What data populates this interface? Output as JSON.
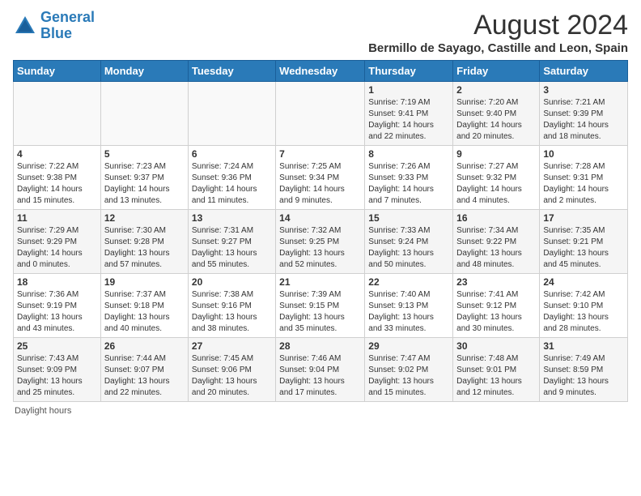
{
  "logo": {
    "line1": "General",
    "line2": "Blue"
  },
  "title": "August 2024",
  "subtitle": "Bermillo de Sayago, Castille and Leon, Spain",
  "headers": [
    "Sunday",
    "Monday",
    "Tuesday",
    "Wednesday",
    "Thursday",
    "Friday",
    "Saturday"
  ],
  "footer": "Daylight hours",
  "weeks": [
    [
      {
        "day": "",
        "info": ""
      },
      {
        "day": "",
        "info": ""
      },
      {
        "day": "",
        "info": ""
      },
      {
        "day": "",
        "info": ""
      },
      {
        "day": "1",
        "info": "Sunrise: 7:19 AM\nSunset: 9:41 PM\nDaylight: 14 hours\nand 22 minutes."
      },
      {
        "day": "2",
        "info": "Sunrise: 7:20 AM\nSunset: 9:40 PM\nDaylight: 14 hours\nand 20 minutes."
      },
      {
        "day": "3",
        "info": "Sunrise: 7:21 AM\nSunset: 9:39 PM\nDaylight: 14 hours\nand 18 minutes."
      }
    ],
    [
      {
        "day": "4",
        "info": "Sunrise: 7:22 AM\nSunset: 9:38 PM\nDaylight: 14 hours\nand 15 minutes."
      },
      {
        "day": "5",
        "info": "Sunrise: 7:23 AM\nSunset: 9:37 PM\nDaylight: 14 hours\nand 13 minutes."
      },
      {
        "day": "6",
        "info": "Sunrise: 7:24 AM\nSunset: 9:36 PM\nDaylight: 14 hours\nand 11 minutes."
      },
      {
        "day": "7",
        "info": "Sunrise: 7:25 AM\nSunset: 9:34 PM\nDaylight: 14 hours\nand 9 minutes."
      },
      {
        "day": "8",
        "info": "Sunrise: 7:26 AM\nSunset: 9:33 PM\nDaylight: 14 hours\nand 7 minutes."
      },
      {
        "day": "9",
        "info": "Sunrise: 7:27 AM\nSunset: 9:32 PM\nDaylight: 14 hours\nand 4 minutes."
      },
      {
        "day": "10",
        "info": "Sunrise: 7:28 AM\nSunset: 9:31 PM\nDaylight: 14 hours\nand 2 minutes."
      }
    ],
    [
      {
        "day": "11",
        "info": "Sunrise: 7:29 AM\nSunset: 9:29 PM\nDaylight: 14 hours\nand 0 minutes."
      },
      {
        "day": "12",
        "info": "Sunrise: 7:30 AM\nSunset: 9:28 PM\nDaylight: 13 hours\nand 57 minutes."
      },
      {
        "day": "13",
        "info": "Sunrise: 7:31 AM\nSunset: 9:27 PM\nDaylight: 13 hours\nand 55 minutes."
      },
      {
        "day": "14",
        "info": "Sunrise: 7:32 AM\nSunset: 9:25 PM\nDaylight: 13 hours\nand 52 minutes."
      },
      {
        "day": "15",
        "info": "Sunrise: 7:33 AM\nSunset: 9:24 PM\nDaylight: 13 hours\nand 50 minutes."
      },
      {
        "day": "16",
        "info": "Sunrise: 7:34 AM\nSunset: 9:22 PM\nDaylight: 13 hours\nand 48 minutes."
      },
      {
        "day": "17",
        "info": "Sunrise: 7:35 AM\nSunset: 9:21 PM\nDaylight: 13 hours\nand 45 minutes."
      }
    ],
    [
      {
        "day": "18",
        "info": "Sunrise: 7:36 AM\nSunset: 9:19 PM\nDaylight: 13 hours\nand 43 minutes."
      },
      {
        "day": "19",
        "info": "Sunrise: 7:37 AM\nSunset: 9:18 PM\nDaylight: 13 hours\nand 40 minutes."
      },
      {
        "day": "20",
        "info": "Sunrise: 7:38 AM\nSunset: 9:16 PM\nDaylight: 13 hours\nand 38 minutes."
      },
      {
        "day": "21",
        "info": "Sunrise: 7:39 AM\nSunset: 9:15 PM\nDaylight: 13 hours\nand 35 minutes."
      },
      {
        "day": "22",
        "info": "Sunrise: 7:40 AM\nSunset: 9:13 PM\nDaylight: 13 hours\nand 33 minutes."
      },
      {
        "day": "23",
        "info": "Sunrise: 7:41 AM\nSunset: 9:12 PM\nDaylight: 13 hours\nand 30 minutes."
      },
      {
        "day": "24",
        "info": "Sunrise: 7:42 AM\nSunset: 9:10 PM\nDaylight: 13 hours\nand 28 minutes."
      }
    ],
    [
      {
        "day": "25",
        "info": "Sunrise: 7:43 AM\nSunset: 9:09 PM\nDaylight: 13 hours\nand 25 minutes."
      },
      {
        "day": "26",
        "info": "Sunrise: 7:44 AM\nSunset: 9:07 PM\nDaylight: 13 hours\nand 22 minutes."
      },
      {
        "day": "27",
        "info": "Sunrise: 7:45 AM\nSunset: 9:06 PM\nDaylight: 13 hours\nand 20 minutes."
      },
      {
        "day": "28",
        "info": "Sunrise: 7:46 AM\nSunset: 9:04 PM\nDaylight: 13 hours\nand 17 minutes."
      },
      {
        "day": "29",
        "info": "Sunrise: 7:47 AM\nSunset: 9:02 PM\nDaylight: 13 hours\nand 15 minutes."
      },
      {
        "day": "30",
        "info": "Sunrise: 7:48 AM\nSunset: 9:01 PM\nDaylight: 13 hours\nand 12 minutes."
      },
      {
        "day": "31",
        "info": "Sunrise: 7:49 AM\nSunset: 8:59 PM\nDaylight: 13 hours\nand 9 minutes."
      }
    ]
  ]
}
